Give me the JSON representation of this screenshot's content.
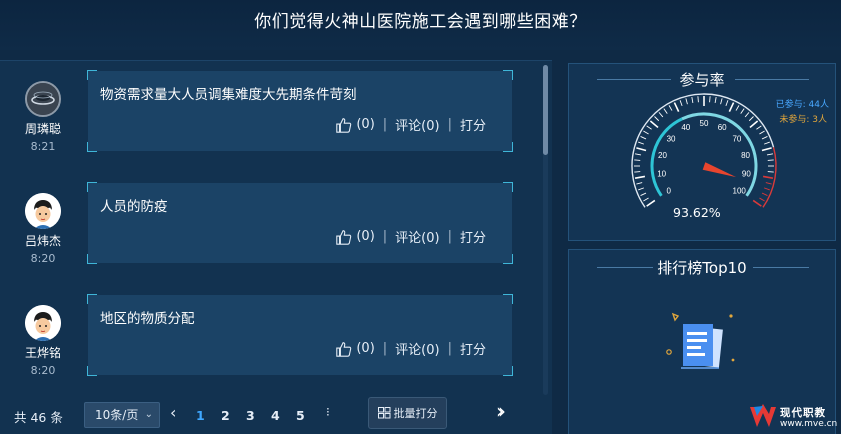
{
  "header": {
    "title": "你们觉得火神山医院施工会遇到哪些困难？"
  },
  "posts": [
    {
      "name": "周璘聪",
      "time": "8:21",
      "text": "物资需求量大人员调集难度大先期条件苛刻",
      "likes": "(0)",
      "comment": "评论(0)",
      "score": "打分",
      "avatar": "dark-planet-avatar"
    },
    {
      "name": "吕炜杰",
      "time": "8:20",
      "text": "人员的防疫",
      "likes": "(0)",
      "comment": "评论(0)",
      "score": "打分",
      "avatar": "cartoon-boy-avatar"
    },
    {
      "name": "王烨铭",
      "time": "8:20",
      "text": "地区的物质分配",
      "likes": "(0)",
      "comment": "评论(0)",
      "score": "打分",
      "avatar": "cartoon-boy-avatar"
    }
  ],
  "pagination": {
    "total": "共 46 条",
    "page_size": "10条/页",
    "pages": [
      "1",
      "2",
      "3",
      "4",
      "5"
    ],
    "current_page": "1",
    "more": "⁝",
    "batch_label": "批量打分"
  },
  "participation": {
    "title": "参与率",
    "joined": "已参与: 44人",
    "not_joined": "未参与: 3人",
    "percent_label": "93.62%",
    "percent_value": 93.62,
    "gauge_ticks": [
      "0",
      "10",
      "20",
      "30",
      "40",
      "50",
      "60",
      "70",
      "80",
      "90",
      "100"
    ],
    "colors": {
      "joined": "#49a8ff",
      "not_joined": "#e2a73c",
      "needle": "#e8452e",
      "arc_inner": "#2ec5d6",
      "arc_outer": "#d93a3a"
    }
  },
  "ranking": {
    "title": "排行榜Top10"
  },
  "brand": {
    "name": "现代职教",
    "url": "www.mve.cn"
  }
}
